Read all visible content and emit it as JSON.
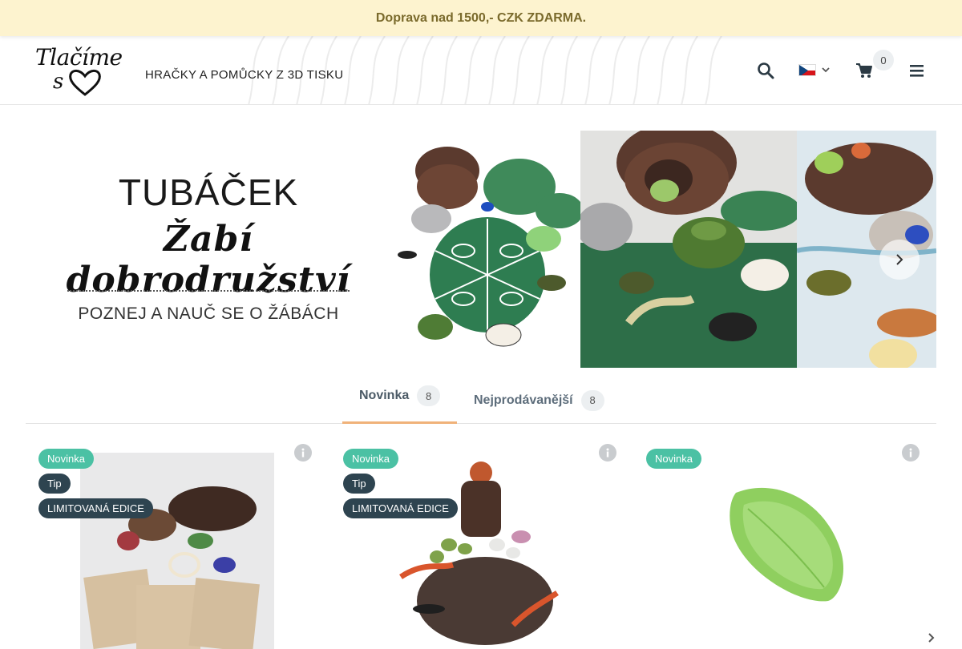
{
  "promo": {
    "text": "Doprava nad 1500,- CZK ZDARMA."
  },
  "header": {
    "logo_word": "Tlačíme",
    "logo_s": "s",
    "tagline": "HRAČKY A POMŮCKY Z 3D TISKU",
    "cart_count": "0",
    "language": "cs"
  },
  "hero": {
    "title": "TUBÁČEK",
    "subtitle": "Žabí dobrodružství",
    "note": "POZNEJ A NAUČ SE O ŽÁBÁCH"
  },
  "tabs": [
    {
      "label": "Novinka",
      "count": "8"
    },
    {
      "label": "Nejprodávanější",
      "count": "8"
    }
  ],
  "products": [
    {
      "badges": [
        "Novinka",
        "Tip",
        "LIMITOVANÁ EDICE"
      ]
    },
    {
      "badges": [
        "Novinka",
        "Tip",
        "LIMITOVANÁ EDICE"
      ]
    },
    {
      "badges": [
        "Novinka"
      ]
    }
  ],
  "colors": {
    "promo_bg": "#fdf3cf",
    "badge_new": "#4bc1a4",
    "badge_dark": "#2e4450",
    "tab_active_underline": "#f0b27a",
    "product_green": "#8fcf5f"
  }
}
